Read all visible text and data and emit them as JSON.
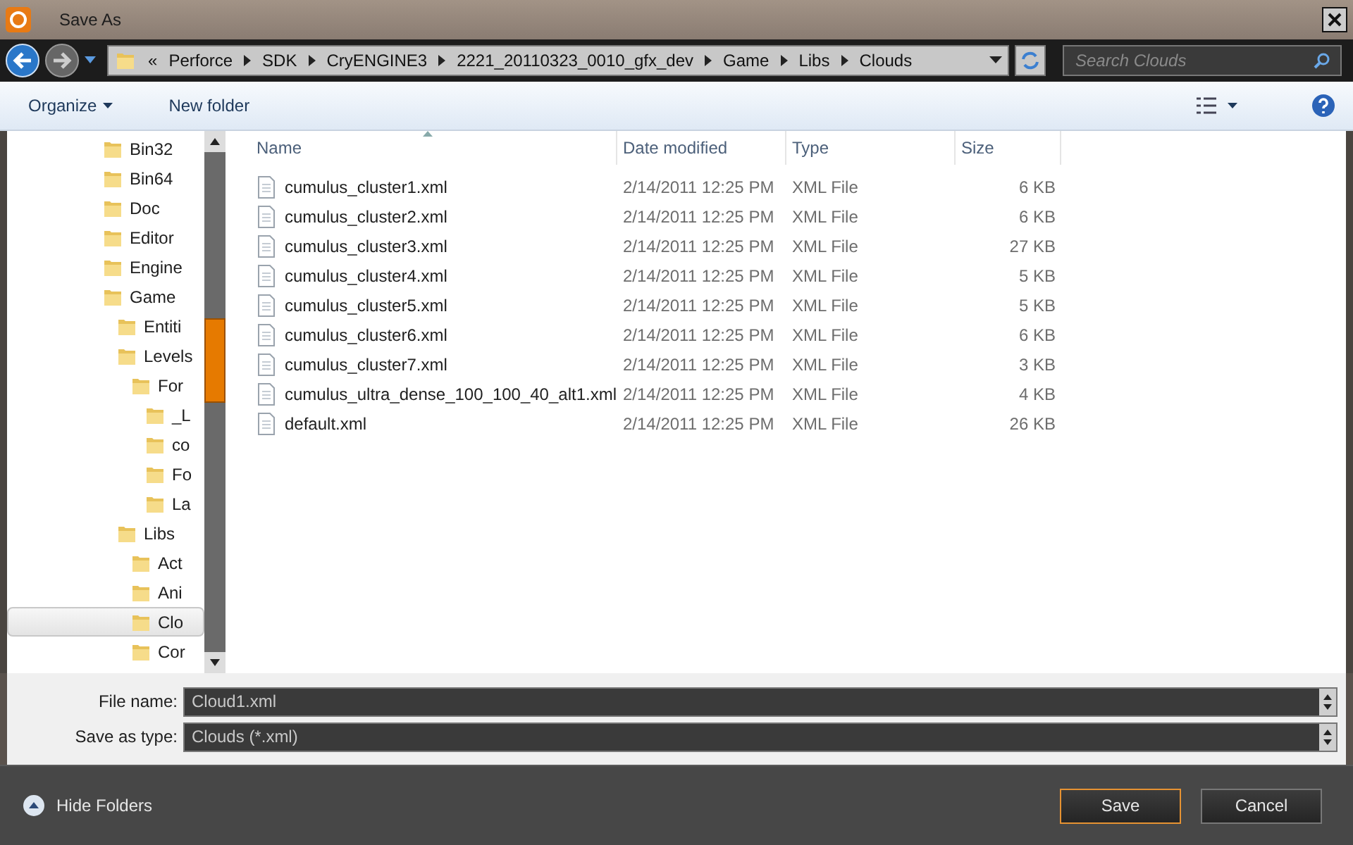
{
  "window": {
    "title": "Save As"
  },
  "address_bar": {
    "overflow": "«",
    "segments": [
      "Perforce",
      "SDK",
      "CryENGINE3",
      "2221_20110323_0010_gfx_dev",
      "Game",
      "Libs",
      "Clouds"
    ]
  },
  "search": {
    "placeholder": "Search Clouds"
  },
  "toolbar": {
    "buttons": [
      "Organize",
      "New folder"
    ]
  },
  "folder_tree": [
    {
      "label": "Bin32",
      "selected": false
    },
    {
      "label": "Bin64",
      "selected": false
    },
    {
      "label": "Doc",
      "selected": false
    },
    {
      "label": "Editor",
      "selected": false
    },
    {
      "label": "Engine",
      "selected": false
    },
    {
      "label": "Game",
      "selected": false,
      "children": [
        {
          "label": "Entiti",
          "selected": false
        },
        {
          "label": "Levels",
          "selected": false,
          "children": [
            {
              "label": "For",
              "selected": false,
              "children": [
                {
                  "label": "_L",
                  "selected": false
                },
                {
                  "label": "co",
                  "selected": false
                },
                {
                  "label": "Fo",
                  "selected": false
                },
                {
                  "label": "La",
                  "selected": false
                }
              ]
            }
          ]
        },
        {
          "label": "Libs",
          "selected": false,
          "children": [
            {
              "label": "Act",
              "selected": false
            },
            {
              "label": "Ani",
              "selected": false
            },
            {
              "label": "Clo",
              "selected": true
            },
            {
              "label": "Cor",
              "selected": false
            }
          ]
        }
      ]
    }
  ],
  "table": {
    "columns": [
      "Name",
      "Date modified",
      "Type",
      "Size"
    ],
    "rows": [
      [
        "cumulus_cluster1.xml",
        "2/14/2011 12:25 PM",
        "XML File",
        "6 KB"
      ],
      [
        "cumulus_cluster2.xml",
        "2/14/2011 12:25 PM",
        "XML File",
        "6 KB"
      ],
      [
        "cumulus_cluster3.xml",
        "2/14/2011 12:25 PM",
        "XML File",
        "27 KB"
      ],
      [
        "cumulus_cluster4.xml",
        "2/14/2011 12:25 PM",
        "XML File",
        "5 KB"
      ],
      [
        "cumulus_cluster5.xml",
        "2/14/2011 12:25 PM",
        "XML File",
        "5 KB"
      ],
      [
        "cumulus_cluster6.xml",
        "2/14/2011 12:25 PM",
        "XML File",
        "6 KB"
      ],
      [
        "cumulus_cluster7.xml",
        "2/14/2011 12:25 PM",
        "XML File",
        "3 KB"
      ],
      [
        "cumulus_ultra_dense_100_100_40_alt1.xml",
        "2/14/2011 12:25 PM",
        "XML File",
        "4 KB"
      ],
      [
        "default.xml",
        "2/14/2011 12:25 PM",
        "XML File",
        "26 KB"
      ]
    ]
  },
  "fields": [
    {
      "label": "File name:",
      "value": "Cloud1.xml"
    },
    {
      "label": "Save as type:",
      "value": "Clouds (*.xml)"
    }
  ],
  "footer": {
    "toggle": "Hide Folders",
    "buttons": [
      {
        "label": "Save",
        "selected": true
      },
      {
        "label": "Cancel",
        "selected": false
      }
    ]
  }
}
